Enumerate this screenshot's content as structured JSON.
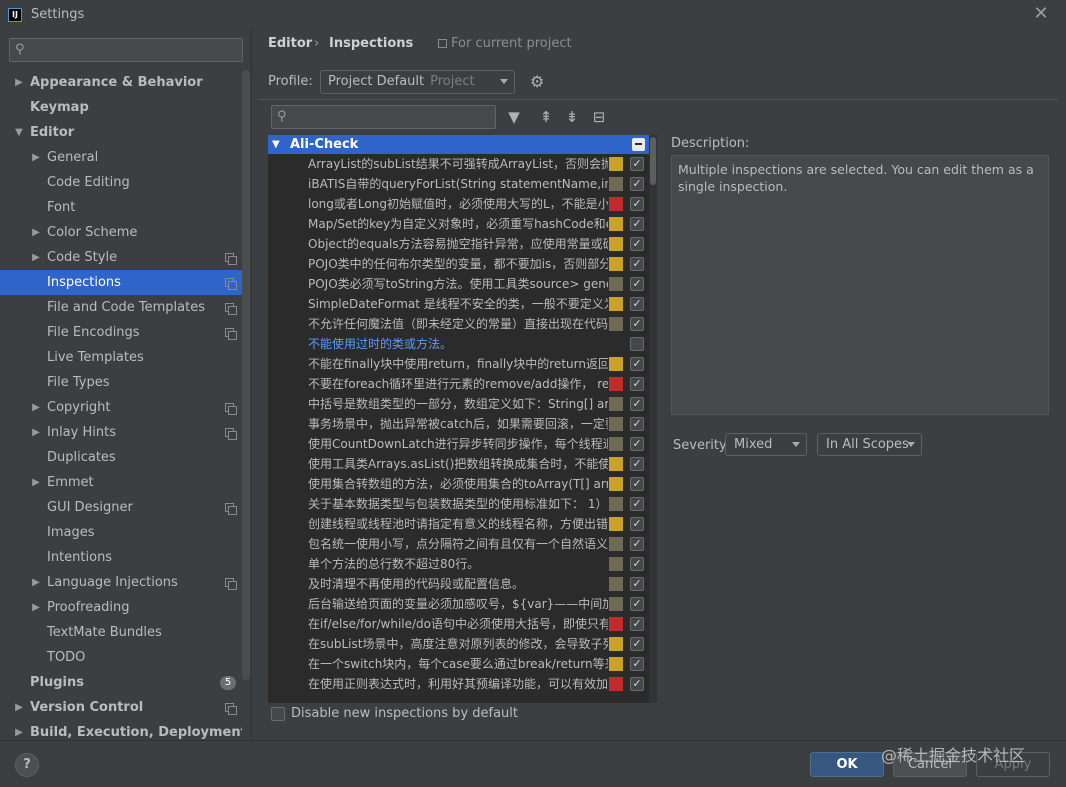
{
  "window": {
    "title": "Settings",
    "app_icon": "IJ"
  },
  "sidebar": {
    "search_placeholder": "",
    "items": [
      {
        "label": "Appearance & Behavior",
        "bold": true,
        "level": 0,
        "arrow": "▶",
        "copy": false
      },
      {
        "label": "Keymap",
        "bold": true,
        "level": 0,
        "arrow": "",
        "copy": false
      },
      {
        "label": "Editor",
        "bold": true,
        "level": 0,
        "arrow": "▼",
        "copy": false
      },
      {
        "label": "General",
        "bold": false,
        "level": 1,
        "arrow": "▶",
        "copy": false
      },
      {
        "label": "Code Editing",
        "bold": false,
        "level": 1,
        "arrow": "",
        "copy": false
      },
      {
        "label": "Font",
        "bold": false,
        "level": 1,
        "arrow": "",
        "copy": false
      },
      {
        "label": "Color Scheme",
        "bold": false,
        "level": 1,
        "arrow": "▶",
        "copy": false
      },
      {
        "label": "Code Style",
        "bold": false,
        "level": 1,
        "arrow": "▶",
        "copy": true
      },
      {
        "label": "Inspections",
        "bold": false,
        "level": 1,
        "arrow": "",
        "copy": true,
        "selected": true
      },
      {
        "label": "File and Code Templates",
        "bold": false,
        "level": 1,
        "arrow": "",
        "copy": true
      },
      {
        "label": "File Encodings",
        "bold": false,
        "level": 1,
        "arrow": "",
        "copy": true
      },
      {
        "label": "Live Templates",
        "bold": false,
        "level": 1,
        "arrow": "",
        "copy": false
      },
      {
        "label": "File Types",
        "bold": false,
        "level": 1,
        "arrow": "",
        "copy": false
      },
      {
        "label": "Copyright",
        "bold": false,
        "level": 1,
        "arrow": "▶",
        "copy": true
      },
      {
        "label": "Inlay Hints",
        "bold": false,
        "level": 1,
        "arrow": "▶",
        "copy": true
      },
      {
        "label": "Duplicates",
        "bold": false,
        "level": 1,
        "arrow": "",
        "copy": false
      },
      {
        "label": "Emmet",
        "bold": false,
        "level": 1,
        "arrow": "▶",
        "copy": false
      },
      {
        "label": "GUI Designer",
        "bold": false,
        "level": 1,
        "arrow": "",
        "copy": true
      },
      {
        "label": "Images",
        "bold": false,
        "level": 1,
        "arrow": "",
        "copy": false
      },
      {
        "label": "Intentions",
        "bold": false,
        "level": 1,
        "arrow": "",
        "copy": false
      },
      {
        "label": "Language Injections",
        "bold": false,
        "level": 1,
        "arrow": "▶",
        "copy": true
      },
      {
        "label": "Proofreading",
        "bold": false,
        "level": 1,
        "arrow": "▶",
        "copy": false
      },
      {
        "label": "TextMate Bundles",
        "bold": false,
        "level": 1,
        "arrow": "",
        "copy": false
      },
      {
        "label": "TODO",
        "bold": false,
        "level": 1,
        "arrow": "",
        "copy": false
      },
      {
        "label": "Plugins",
        "bold": true,
        "level": 0,
        "arrow": "",
        "copy": false,
        "badge": "5"
      },
      {
        "label": "Version Control",
        "bold": true,
        "level": 0,
        "arrow": "▶",
        "copy": true
      },
      {
        "label": "Build, Execution, Deployment",
        "bold": true,
        "level": 0,
        "arrow": "▶",
        "copy": false
      }
    ]
  },
  "breadcrumb": {
    "editor": "Editor",
    "separator": "›",
    "inspections": "Inspections",
    "scope_note": "For current project"
  },
  "profile": {
    "label": "Profile:",
    "value": "Project Default",
    "sub": "Project"
  },
  "inspections": {
    "search_placeholder": "",
    "group": {
      "label": "Ali-Check"
    },
    "rows": [
      {
        "text": "ArrayList的subList结果不可强转成ArrayList，否则会抛出",
        "severity": "#c9a227",
        "checked": true,
        "link": false
      },
      {
        "text": "iBATIS自带的queryForList(String statementName,int s",
        "severity": "#6e6a54",
        "checked": true,
        "link": false
      },
      {
        "text": "long或者Long初始赋值时，必须使用大写的L，不能是小",
        "severity": "#c02b2b",
        "checked": true,
        "link": false
      },
      {
        "text": "Map/Set的key为自定义对象时，必须重写hashCode和e",
        "severity": "#c9a227",
        "checked": true,
        "link": false
      },
      {
        "text": "Object的equals方法容易抛空指针异常，应使用常量或确",
        "severity": "#c9a227",
        "checked": true,
        "link": false
      },
      {
        "text": "POJO类中的任何布尔类型的变量，都不要加is，否则部分",
        "severity": "#c9a227",
        "checked": true,
        "link": false
      },
      {
        "text": "POJO类必须写toString方法。使用工具类source> gene",
        "severity": "#6e6a54",
        "checked": true,
        "link": false
      },
      {
        "text": "SimpleDateFormat 是线程不安全的类，一般不要定义为",
        "severity": "#c9a227",
        "checked": true,
        "link": false
      },
      {
        "text": "不允许任何魔法值（即未经定义的常量）直接出现在代码",
        "severity": "#6e6a54",
        "checked": true,
        "link": false
      },
      {
        "text": "不能使用过时的类或方法。",
        "severity": "",
        "checked": false,
        "link": true
      },
      {
        "text": "不能在finally块中使用return，finally块中的return返回后",
        "severity": "#c9a227",
        "checked": true,
        "link": false
      },
      {
        "text": "不要在foreach循环里进行元素的remove/add操作， rem",
        "severity": "#c02b2b",
        "checked": true,
        "link": false
      },
      {
        "text": "中括号是数组类型的一部分，数组定义如下：String[] arg",
        "severity": "#6e6a54",
        "checked": true,
        "link": false
      },
      {
        "text": "事务场景中，抛出异常被catch后，如果需要回滚，一定要",
        "severity": "#6e6a54",
        "checked": true,
        "link": false
      },
      {
        "text": "使用CountDownLatch进行异步转同步操作，每个线程退",
        "severity": "#6e6a54",
        "checked": true,
        "link": false
      },
      {
        "text": "使用工具类Arrays.asList()把数组转换成集合时，不能使用",
        "severity": "#c9a227",
        "checked": true,
        "link": false
      },
      {
        "text": "使用集合转数组的方法，必须使用集合的toArray(T[] arra",
        "severity": "#c9a227",
        "checked": true,
        "link": false
      },
      {
        "text": "关于基本数据类型与包装数据类型的使用标准如下：  1）",
        "severity": "#6e6a54",
        "checked": true,
        "link": false
      },
      {
        "text": "创建线程或线程池时请指定有意义的线程名称，方便出错",
        "severity": "#c9a227",
        "checked": true,
        "link": false
      },
      {
        "text": "包名统一使用小写，点分隔符之间有且仅有一个自然语义",
        "severity": "#6e6a54",
        "checked": true,
        "link": false
      },
      {
        "text": "单个方法的总行数不超过80行。",
        "severity": "#6e6a54",
        "checked": true,
        "link": false
      },
      {
        "text": "及时清理不再使用的代码段或配置信息。",
        "severity": "#6e6a54",
        "checked": true,
        "link": false
      },
      {
        "text": "后台输送给页面的变量必须加感叹号，${var}——中间加",
        "severity": "#6e6a54",
        "checked": true,
        "link": false
      },
      {
        "text": "在if/else/for/while/do语句中必须使用大括号，即使只有",
        "severity": "#c02b2b",
        "checked": true,
        "link": false
      },
      {
        "text": "在subList场景中，高度注意对原列表的修改，会导致子列",
        "severity": "#c9a227",
        "checked": true,
        "link": false
      },
      {
        "text": "在一个switch块内，每个case要么通过break/return等来",
        "severity": "#c9a227",
        "checked": true,
        "link": false
      },
      {
        "text": "在使用正则表达式时，利用好其预编译功能，可以有效加",
        "severity": "#c02b2b",
        "checked": true,
        "link": false
      }
    ]
  },
  "description": {
    "label": "Description:",
    "text": "Multiple inspections are selected. You can edit them as a single inspection."
  },
  "severity": {
    "label": "Severity:",
    "value": "Mixed",
    "scope": "In All Scopes"
  },
  "disable_new": {
    "label": "Disable new inspections by default"
  },
  "buttons": {
    "help": "?",
    "ok": "OK",
    "cancel": "Cancel",
    "apply": "Apply"
  },
  "watermark": "@稀土掘金技术社区"
}
